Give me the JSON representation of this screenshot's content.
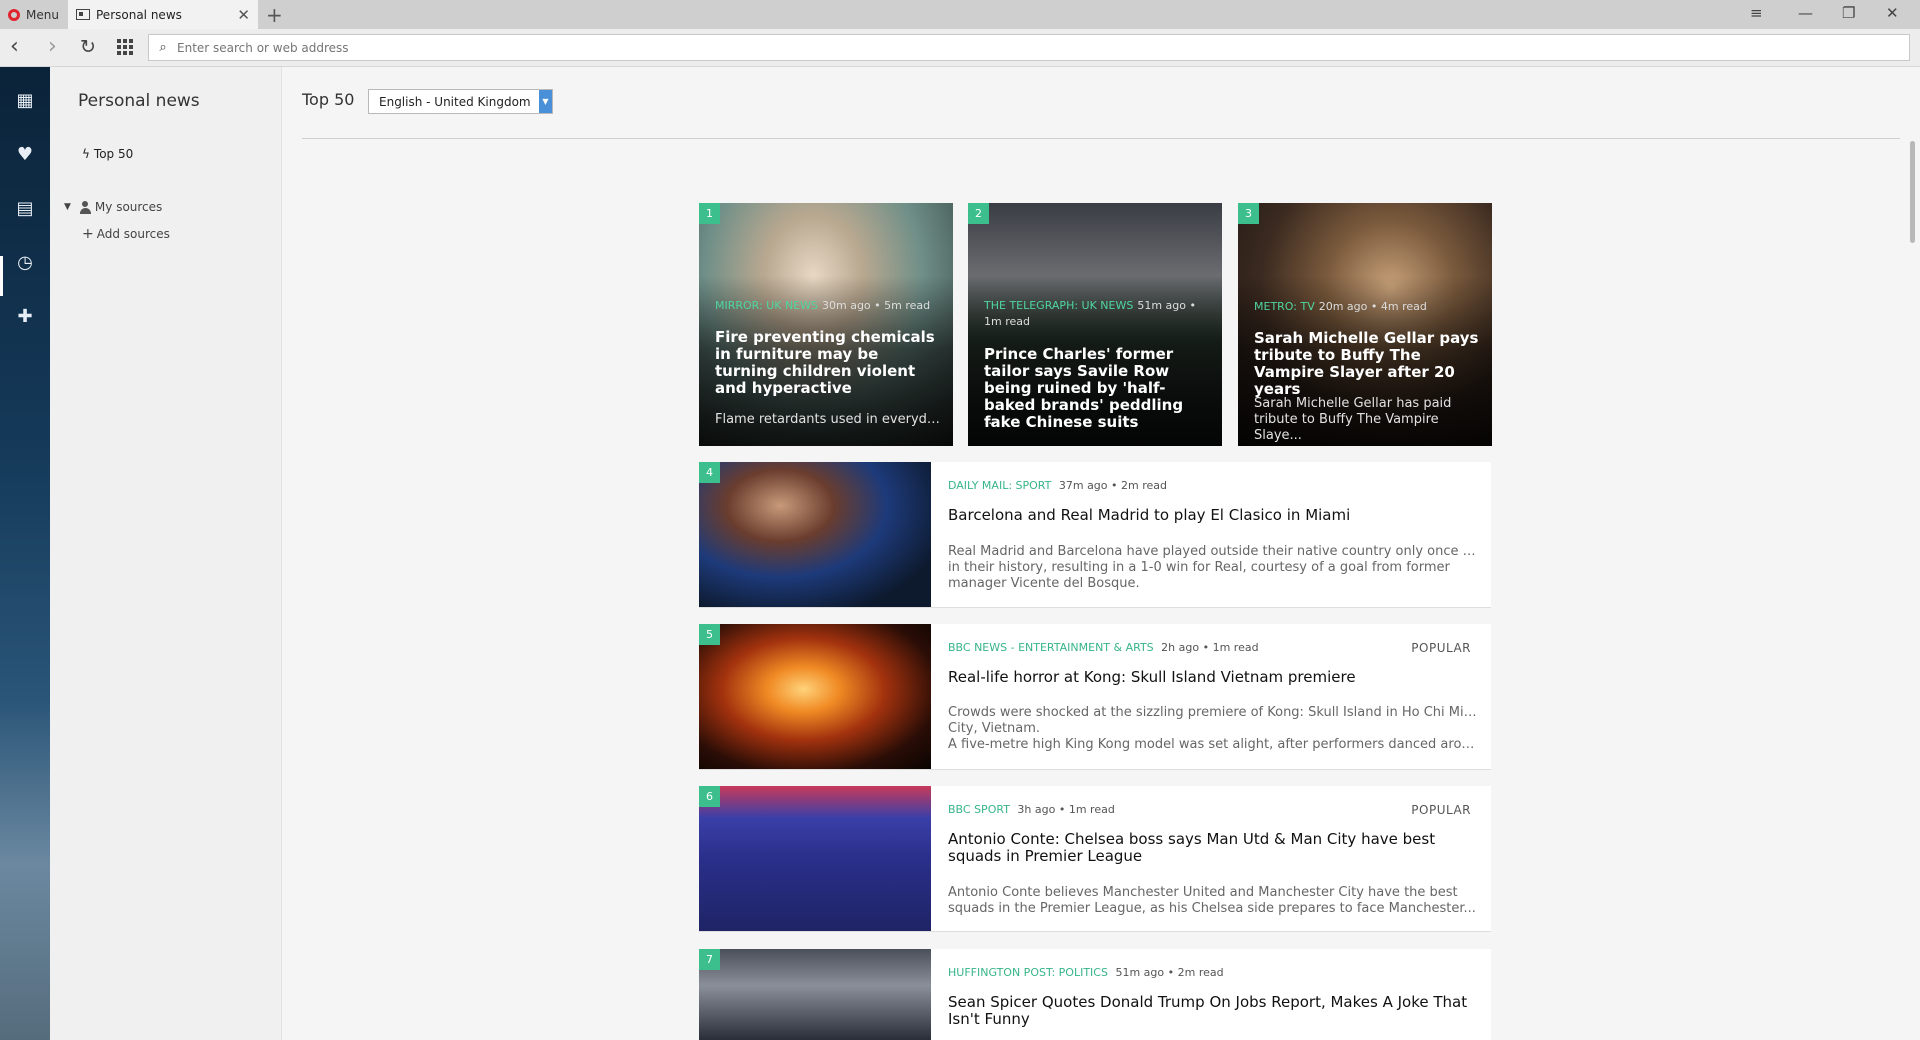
{
  "browser": {
    "menu_label": "Menu",
    "tab_title": "Personal news",
    "address_placeholder": "Enter search or web address"
  },
  "panel": {
    "title": "Personal news",
    "top50_label": "Top 50",
    "my_sources_label": "My sources",
    "add_sources_label": "Add sources"
  },
  "main": {
    "heading": "Top 50",
    "language": "English - United Kingdom"
  },
  "cards": [
    {
      "num": "1",
      "source": "MIRROR: UK NEWS",
      "meta": "30m ago • 5m read",
      "title": "Fire preventing chemicals in furniture may be turning children violent and hyperactive",
      "desc": "Flame retardants used in everyday..."
    },
    {
      "num": "2",
      "source": "THE TELEGRAPH: UK NEWS",
      "meta": "51m ago • 1m read",
      "title": "Prince Charles' former tailor says Savile Row being ruined by 'half-baked brands' peddling fake Chinese suits",
      "desc": "..."
    },
    {
      "num": "3",
      "source": "METRO: TV",
      "meta": "20m ago • 4m read",
      "title": "Sarah Michelle Gellar pays tribute to Buffy The Vampire Slayer after 20 years",
      "desc": "Sarah Michelle Gellar has paid tribute to Buffy The Vampire Slaye..."
    }
  ],
  "items": [
    {
      "num": "4",
      "source": "DAILY MAIL: SPORT",
      "meta": "37m ago • 2m read",
      "popular": "",
      "title": "Barcelona and Real Madrid to play El Clasico in Miami",
      "desc1": "Real Madrid and Barcelona have played outside their native country only once before",
      "desc2": "in their history, resulting in a 1-0 win for Real, courtesy of a goal from former",
      "desc3": "manager Vicente del Bosque."
    },
    {
      "num": "5",
      "source": "BBC NEWS - ENTERTAINMENT & ARTS",
      "meta": "2h ago • 1m read",
      "popular": "POPULAR",
      "title": "Real-life horror at Kong: Skull Island Vietnam premiere",
      "desc1": "Crowds were shocked at the sizzling premiere of Kong: Skull Island in Ho Chi Minh",
      "desc2": "City, Vietnam.",
      "desc3": "A five-metre high King Kong model was set alight, after performers danced around a..."
    },
    {
      "num": "6",
      "source": "BBC SPORT",
      "meta": "3h ago • 1m read",
      "popular": "POPULAR",
      "title": "Antonio Conte: Chelsea boss says Man Utd & Man City have best squads in Premier League",
      "desc1": "Antonio Conte believes Manchester United and Manchester City have the best",
      "desc2": "squads in the Premier League, as his Chelsea side prepares to face Manchester...",
      "desc3": ""
    },
    {
      "num": "7",
      "source": "HUFFINGTON POST: POLITICS",
      "meta": "51m ago • 2m read",
      "popular": "",
      "title": "Sean Spicer Quotes Donald Trump On Jobs Report, Makes A Joke That Isn't Funny",
      "desc1": "",
      "desc2": "",
      "desc3": ""
    }
  ],
  "colors": {
    "accent_green": "#3cbf8d",
    "source_green": "#37b588",
    "select_blue": "#4a90d9"
  },
  "icons": {
    "sidebar": [
      "speed-dial-icon",
      "heart-icon",
      "news-icon",
      "history-icon",
      "extensions-icon"
    ]
  }
}
